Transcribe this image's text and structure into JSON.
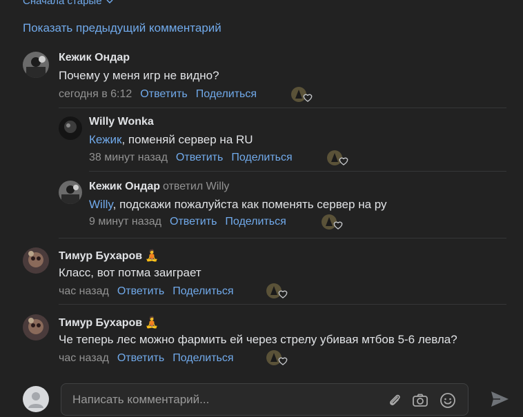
{
  "sort": {
    "label": "Сначала старые"
  },
  "show_previous": "Показать предыдущий комментарий",
  "comments": [
    {
      "author": "Кежик Ондар",
      "text": "Почему у меня игр не видно?",
      "time": "сегодня в 6:12",
      "reply": "Ответить",
      "share": "Поделиться"
    },
    {
      "author": "Willy Wonka",
      "mention": "Кежик",
      "text": ", поменяй сервер на RU",
      "time": "38 минут назад",
      "reply": "Ответить",
      "share": "Поделиться"
    },
    {
      "author": "Кежик Ондар",
      "replied_to": "ответил Willy",
      "mention": "Willy",
      "text": ", подскажи пожалуйста как поменять сервер на ру",
      "time": "9 минут назад",
      "reply": "Ответить",
      "share": "Поделиться"
    },
    {
      "author": "Тимур Бухаров",
      "emoji": "🧘",
      "text": "Класс, вот потма заиграет",
      "time": "час назад",
      "reply": "Ответить",
      "share": "Поделиться"
    },
    {
      "author": "Тимур Бухаров",
      "emoji": "🧘",
      "text": "Че теперь лес можно фармить ей через стрелу убивая мтбов 5-6 левла?",
      "time": "час назад",
      "reply": "Ответить",
      "share": "Поделиться"
    }
  ],
  "composer": {
    "placeholder": "Написать комментарий..."
  },
  "colors": {
    "background": "#222222",
    "accent": "#71aaeb",
    "muted": "#939393",
    "text": "#e1e3e6"
  }
}
